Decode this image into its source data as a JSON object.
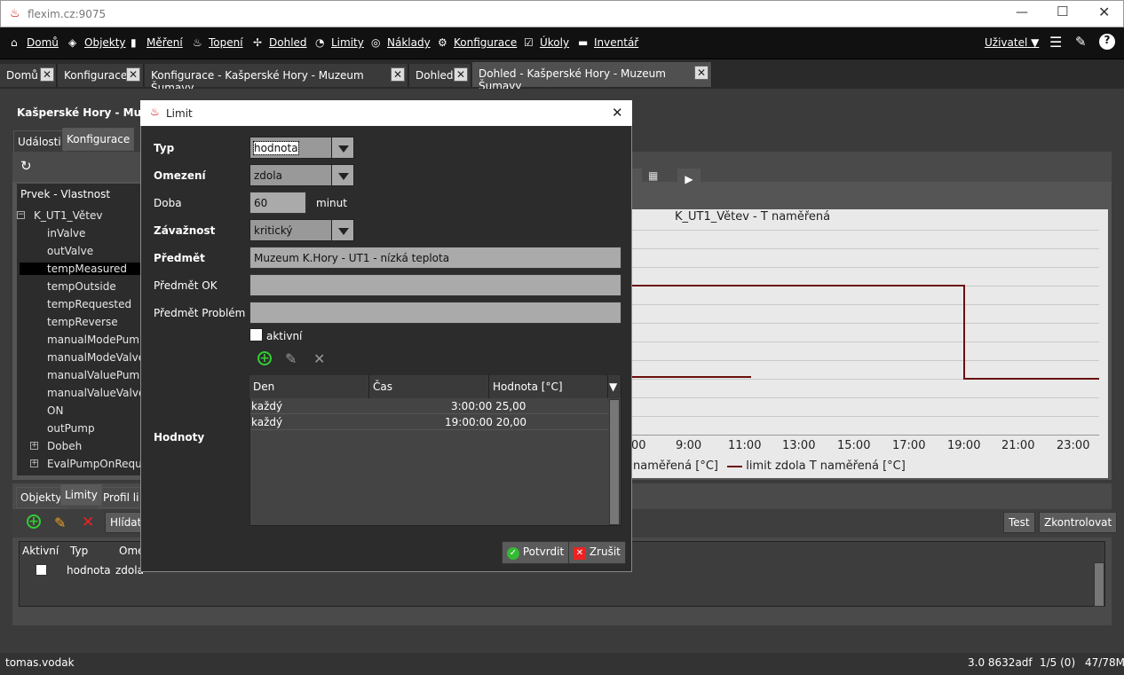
{
  "window": {
    "title": "flexim.cz:9075"
  },
  "menu": {
    "items": [
      {
        "label": "Domů",
        "icon": "home-icon"
      },
      {
        "label": "Objekty",
        "icon": "cube-icon"
      },
      {
        "label": "Měření",
        "icon": "bars-icon"
      },
      {
        "label": "Topení",
        "icon": "flame-icon"
      },
      {
        "label": "Dohled",
        "icon": "pulse-icon"
      },
      {
        "label": "Limity",
        "icon": "gauge-icon"
      },
      {
        "label": "Náklady",
        "icon": "coins-icon"
      },
      {
        "label": "Konfigurace",
        "icon": "gear-icon"
      },
      {
        "label": "Úkoly",
        "icon": "checkbox-icon"
      },
      {
        "label": "Inventář",
        "icon": "folder-icon"
      }
    ],
    "user": "Uživatel"
  },
  "tabs": [
    {
      "label": "Domů"
    },
    {
      "label": "Konfigurace"
    },
    {
      "label": "Konfigurace - Kašperské Hory - Muzeum Šumavy"
    },
    {
      "label": "Dohled"
    },
    {
      "label": "Dohled - Kašperské Hory - Muzeum Šumavy"
    }
  ],
  "page": {
    "title": "Kašperské Hory - Muzeu",
    "subtabs": [
      "Události",
      "Konfigurace"
    ],
    "tree_header": "Prvek - Vlastnost",
    "tree": [
      {
        "label": "K_UT1_Větev",
        "root": true
      },
      {
        "label": "inValve"
      },
      {
        "label": "outValve"
      },
      {
        "label": "tempMeasured",
        "selected": true
      },
      {
        "label": "tempOutside"
      },
      {
        "label": "tempRequested"
      },
      {
        "label": "tempReverse"
      },
      {
        "label": "manualModePump"
      },
      {
        "label": "manualModeValve"
      },
      {
        "label": "manualValuePump"
      },
      {
        "label": "manualValueValve"
      },
      {
        "label": "ON"
      },
      {
        "label": "outPump"
      },
      {
        "label": "Dobeh",
        "expandable": true
      },
      {
        "label": "EvalPumpOnReque",
        "expandable": true
      }
    ]
  },
  "chart": {
    "title": "K_UT1_Větev - T naměřená",
    "x_ticks": [
      "00",
      "9:00",
      "11:00",
      "13:00",
      "15:00",
      "17:00",
      "19:00",
      "21:00",
      "23:00"
    ],
    "legend": [
      {
        "name": "naměřená [°C]"
      },
      {
        "name": "limit zdola T naměřená [°C]",
        "color": "#6b0f0f"
      }
    ]
  },
  "chart_data": {
    "type": "line",
    "title": "K_UT1_Větev - T naměřená",
    "series": [
      {
        "name": "limit zdola T naměřená [°C]",
        "x": [
          "3:00",
          "19:00",
          "19:00",
          "24:00"
        ],
        "values": [
          25,
          25,
          20,
          20
        ]
      }
    ]
  },
  "lower": {
    "tabs": [
      "Objekty",
      "Limity",
      "Profil li"
    ],
    "hide_label": "Hlídat",
    "test_label": "Test",
    "check_label": "Zkontrolovat",
    "columns": [
      "Aktivní",
      "Typ",
      "Ome"
    ],
    "row": {
      "typ": "hodnota",
      "omezeni": "zdola"
    }
  },
  "dialog": {
    "title": "Limit",
    "typ_label": "Typ",
    "typ_value": "hodnota",
    "omezeni_label": "Omezení",
    "omezeni_value": "zdola",
    "doba_label": "Doba",
    "doba_value": "60",
    "doba_unit": "minut",
    "zavaznost_label": "Závažnost",
    "zavaznost_value": "kritický",
    "predmet_label": "Předmět",
    "predmet_value": "Muzeum K.Hory - UT1 - nízká teplota",
    "predmet_ok_label": "Předmět OK",
    "predmet_ok_value": "",
    "predmet_problem_label": "Předmět Problém",
    "predmet_problem_value": "",
    "aktivni_label": "aktivní",
    "hodnoty_label": "Hodnoty",
    "grid_columns": [
      "Den",
      "Čas",
      "Hodnota [°C]"
    ],
    "grid_rows": [
      {
        "den": "každý",
        "cas_hodnota": "3:00:00 25,00"
      },
      {
        "den": "každý",
        "cas_hodnota": "19:00:00 20,00"
      }
    ],
    "confirm_label": "Potvrdit",
    "cancel_label": "Zrušit"
  },
  "status": {
    "user": "tomas.vodak",
    "version": "3.0 8632adf",
    "pages": "1/5 (0)",
    "memory": "47/78M"
  }
}
